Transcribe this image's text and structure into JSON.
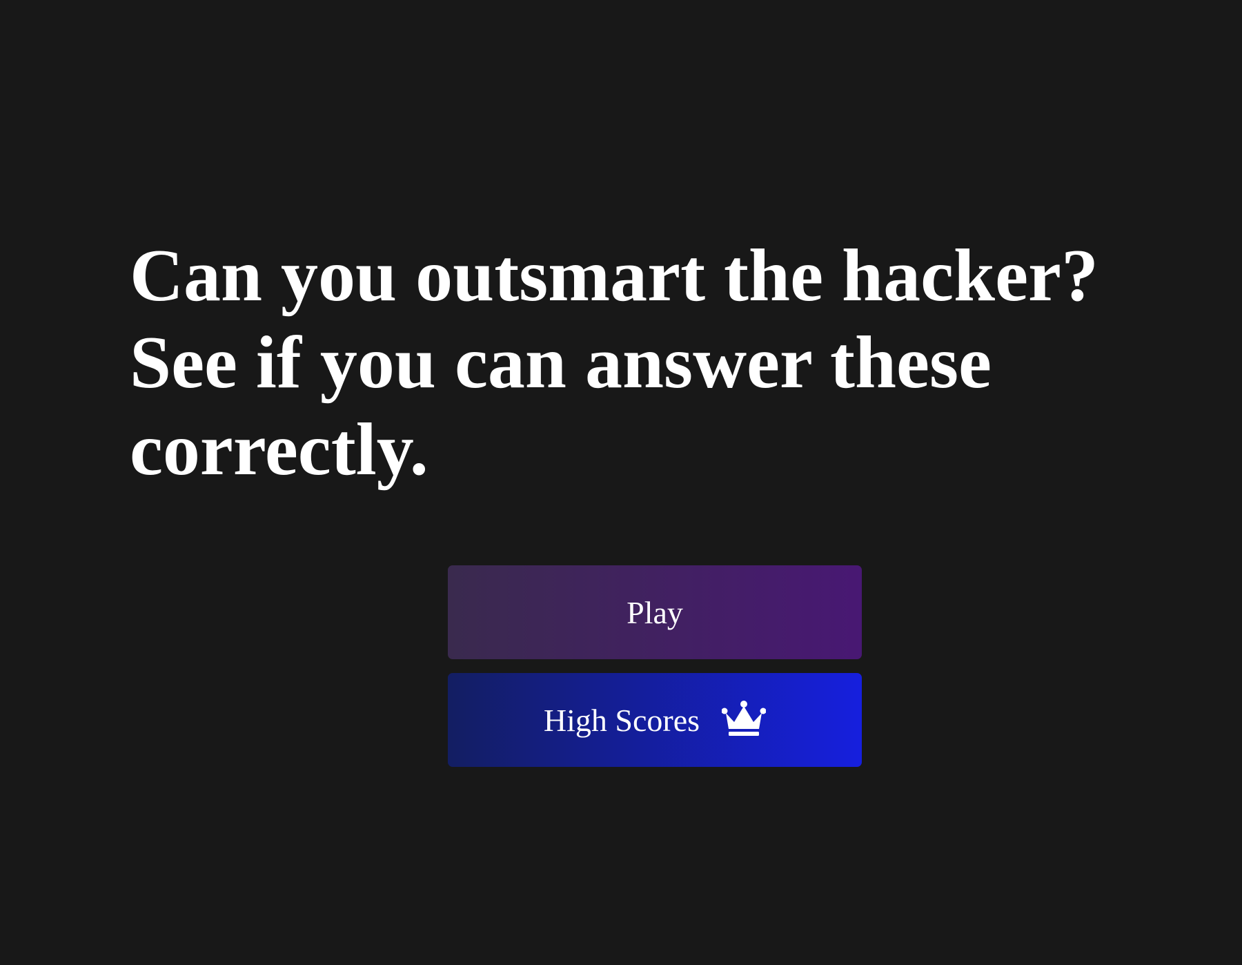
{
  "headline": "Can you outsmart the hacker? See if you can answer these correctly.",
  "buttons": {
    "play_label": "Play",
    "high_scores_label": "High Scores",
    "high_scores_icon": "crown-icon"
  },
  "colors": {
    "background": "#181818",
    "text": "#ffffff",
    "play_gradient_start": "#3a2a4e",
    "play_gradient_end": "#481873",
    "scores_gradient_start": "#131e62",
    "scores_gradient_end": "#161fde"
  }
}
